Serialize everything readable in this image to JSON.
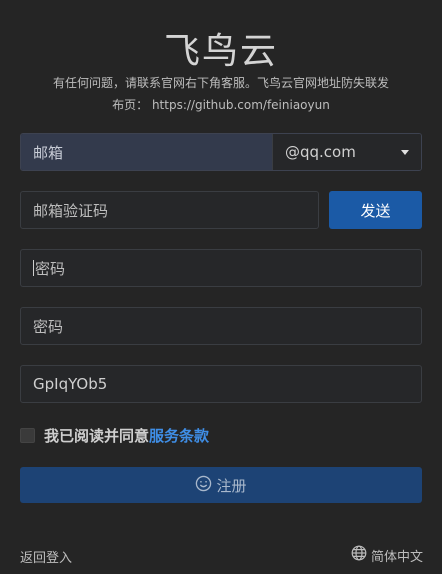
{
  "app_title": "飞鸟云",
  "notice_line1": "有任何问题，请联系官网右下角客服。飞鸟云官网地址防失联发",
  "notice_line2": "布页： https://github.com/feiniaoyun",
  "email": {
    "placeholder": "邮箱",
    "suffix_selected": "@qq.com"
  },
  "verification": {
    "placeholder": "邮箱验证码",
    "send_label": "发送"
  },
  "password": {
    "placeholder": "密码"
  },
  "password_confirm": {
    "placeholder": "密码"
  },
  "invite_code": {
    "value": "GpIqYOb5"
  },
  "agreement": {
    "label": "我已阅读并同意",
    "link": "服务条款",
    "checked": false
  },
  "register_label": "注册",
  "footer": {
    "back_login": "返回登入",
    "language": "简体中文"
  },
  "icons": {
    "register": "smiley-icon",
    "language": "globe-icon",
    "dropdown": "caret-down-icon"
  },
  "colors": {
    "accent": "#1b5aa6",
    "link": "#3f8ee6",
    "background": "#252525"
  }
}
